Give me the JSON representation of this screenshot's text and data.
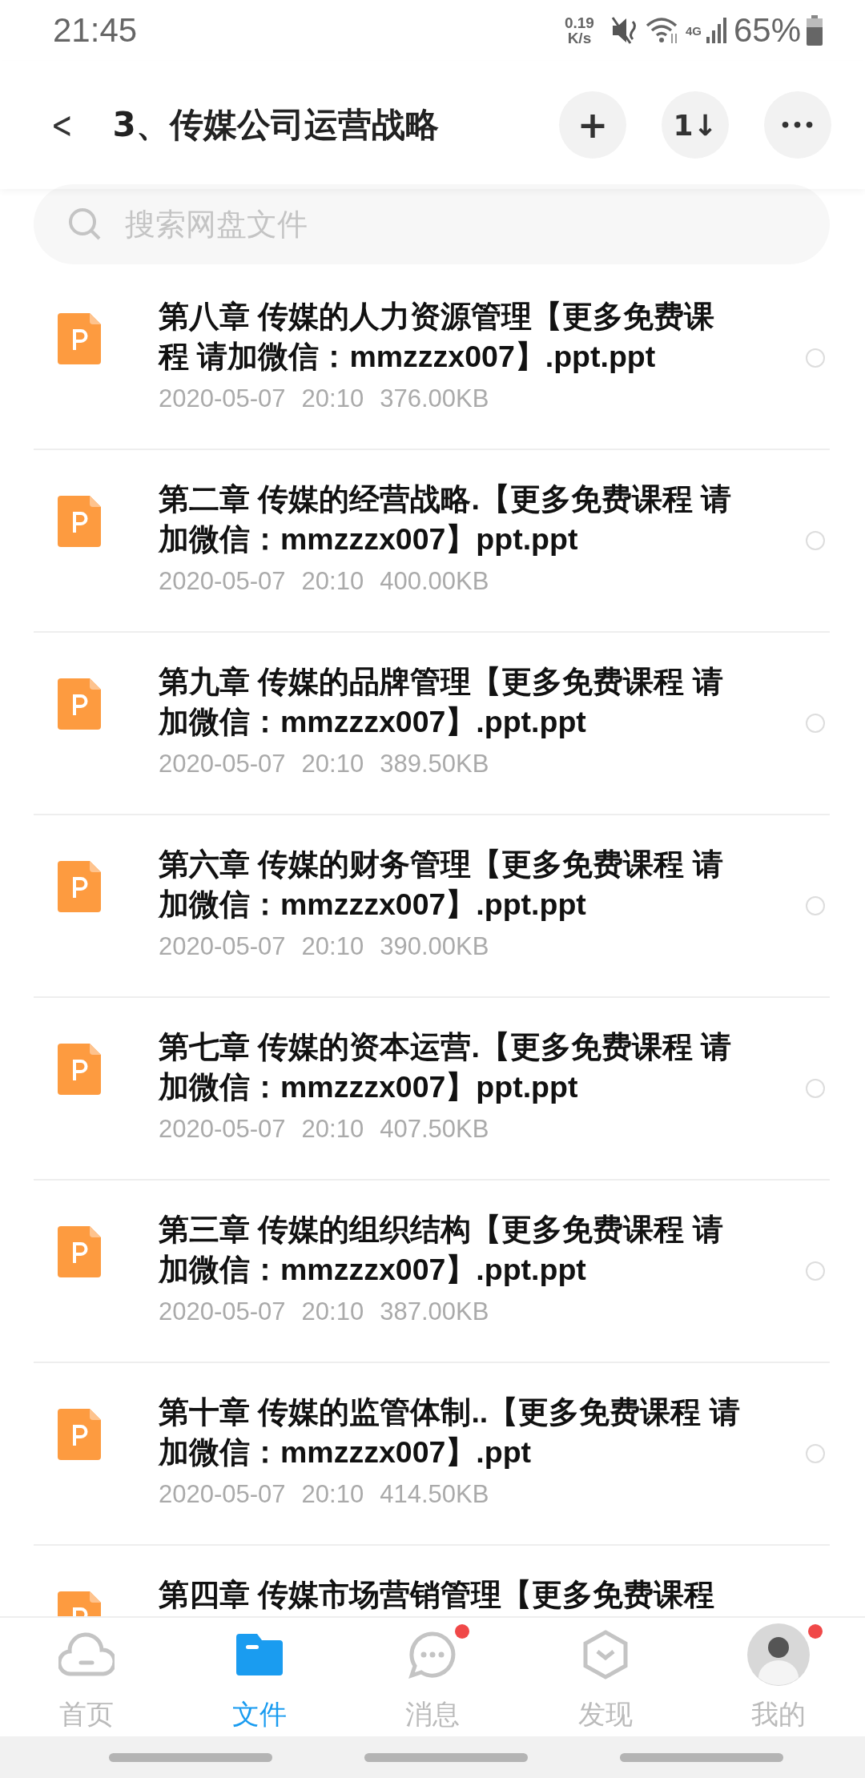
{
  "status_bar": {
    "time": "21:45",
    "speed_value": "0.19",
    "speed_unit": "K/s",
    "network": "4G",
    "battery": "65%"
  },
  "header": {
    "back": "<",
    "title": "3、传媒公司运营战略",
    "actions": [
      {
        "kind": "add",
        "label": "+"
      },
      {
        "kind": "sort",
        "label": "1↓"
      },
      {
        "kind": "more",
        "label": "•••"
      }
    ]
  },
  "search": {
    "placeholder": "搜索网盘文件"
  },
  "files": [
    {
      "name": "第八章 传媒的人力资源管理【更多免费课程 请加微信：mmzzzx007】.ppt.ppt",
      "date": "2020-05-07",
      "time": "20:10",
      "size": "376.00KB",
      "selected": false
    },
    {
      "name": "第二章 传媒的经营战略.【更多免费课程 请加微信：mmzzzx007】ppt.ppt",
      "date": "2020-05-07",
      "time": "20:10",
      "size": "400.00KB",
      "selected": false
    },
    {
      "name": "第九章 传媒的品牌管理【更多免费课程 请加微信：mmzzzx007】.ppt.ppt",
      "date": "2020-05-07",
      "time": "20:10",
      "size": "389.50KB",
      "selected": false
    },
    {
      "name": "第六章 传媒的财务管理【更多免费课程 请加微信：mmzzzx007】.ppt.ppt",
      "date": "2020-05-07",
      "time": "20:10",
      "size": "390.00KB",
      "selected": false
    },
    {
      "name": "第七章 传媒的资本运营.【更多免费课程 请加微信：mmzzzx007】ppt.ppt",
      "date": "2020-05-07",
      "time": "20:10",
      "size": "407.50KB",
      "selected": false
    },
    {
      "name": "第三章 传媒的组织结构【更多免费课程 请加微信：mmzzzx007】.ppt.ppt",
      "date": "2020-05-07",
      "time": "20:10",
      "size": "387.00KB",
      "selected": false
    },
    {
      "name": "第十章 传媒的监管体制..【更多免费课程 请加微信：mmzzzx007】.ppt",
      "date": "2020-05-07",
      "time": "20:10",
      "size": "414.50KB",
      "selected": false
    },
    {
      "name": "第四章 传媒市场营销管理【更多免费课程",
      "partial": true
    }
  ],
  "tabs": [
    {
      "kind": "cloud",
      "label": "首页",
      "selected": false,
      "badge": false
    },
    {
      "kind": "folder",
      "label": "文件",
      "selected": true,
      "badge": false
    },
    {
      "kind": "message",
      "label": "消息",
      "selected": false,
      "badge": true
    },
    {
      "kind": "discover",
      "label": "发现",
      "selected": false,
      "badge": false
    },
    {
      "kind": "avatar",
      "label": "我的",
      "selected": false,
      "badge": true
    }
  ]
}
